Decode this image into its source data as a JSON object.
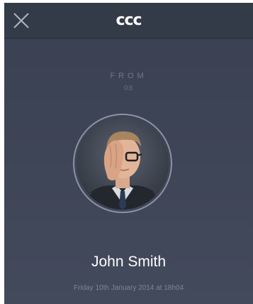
{
  "header": {
    "logo_text": "ccc",
    "close_icon": "close-icon"
  },
  "sender": {
    "from_label": "FROM",
    "from_sub": "08",
    "name": "John Smith",
    "timestamp": "Friday 10th January 2014 at 18h04"
  },
  "colors": {
    "background": "#3d4456",
    "topbar": "#333a48",
    "ring": "#8b93a3",
    "text_primary": "#ffffff",
    "text_muted": "#7d8595"
  }
}
